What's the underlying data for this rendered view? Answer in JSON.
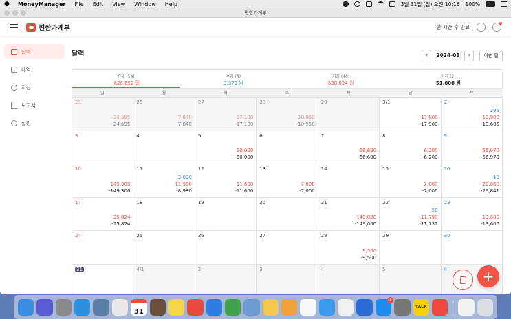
{
  "menubar": {
    "app_name": "MoneyManager",
    "items": [
      "File",
      "Edit",
      "View",
      "Window",
      "Help"
    ],
    "datetime": "3월 31일 (일) 오전 10:16",
    "battery": "100%"
  },
  "window": {
    "title": "편한가계부"
  },
  "appbar": {
    "brand": "편한가계부",
    "sync_label": "한 시간 후 만료"
  },
  "sidebar": {
    "items": [
      {
        "label": "달력"
      },
      {
        "label": "내역"
      },
      {
        "label": "자산"
      },
      {
        "label": "보고서"
      },
      {
        "label": "설정"
      }
    ]
  },
  "main": {
    "title": "달력",
    "month": "2024-03",
    "today_label": "이번 달"
  },
  "summary": [
    {
      "label": "전체 (54)",
      "value": "-626,652 원"
    },
    {
      "label": "수입 (4)",
      "value": "3,372 원"
    },
    {
      "label": "지출 (48)",
      "value": "630,024 원"
    },
    {
      "label": "이체 (2)",
      "value": "51,000 원"
    }
  ],
  "weekdays": [
    "일",
    "월",
    "화",
    "수",
    "목",
    "금",
    "토"
  ],
  "calendar": [
    {
      "day": "25",
      "expense": "24,595",
      "net": "-24,595"
    },
    {
      "day": "26",
      "expense": "7,840",
      "net": "-7,840"
    },
    {
      "day": "27",
      "expense": "17,100",
      "net": "-17,100"
    },
    {
      "day": "28",
      "expense": "10,950",
      "net": "-10,950"
    },
    {
      "day": "29"
    },
    {
      "day": "3/1",
      "expense": "17,900",
      "net": "-17,900"
    },
    {
      "day": "2",
      "income": "295",
      "expense": "10,900",
      "net": "-10,605"
    },
    {
      "day": "3"
    },
    {
      "day": "4"
    },
    {
      "day": "5",
      "expense": "50,000",
      "net": "-50,000"
    },
    {
      "day": "6"
    },
    {
      "day": "7",
      "expense": "66,600",
      "net": "-66,600"
    },
    {
      "day": "8",
      "expense": "6,200",
      "net": "-6,200"
    },
    {
      "day": "9",
      "expense": "56,970",
      "net": "-56,970"
    },
    {
      "day": "10",
      "expense": "149,300",
      "net": "-149,300"
    },
    {
      "day": "11",
      "income": "3,000",
      "expense": "11,980",
      "net": "-8,980"
    },
    {
      "day": "12",
      "expense": "11,600",
      "net": "-11,600"
    },
    {
      "day": "13",
      "expense": "7,000",
      "net": "-7,000"
    },
    {
      "day": "14"
    },
    {
      "day": "15",
      "expense": "2,000",
      "net": "-2,000"
    },
    {
      "day": "16",
      "income": "19",
      "expense": "29,860",
      "net": "-29,841"
    },
    {
      "day": "17",
      "expense": "25,824",
      "net": "-25,824"
    },
    {
      "day": "18"
    },
    {
      "day": "19"
    },
    {
      "day": "20"
    },
    {
      "day": "21",
      "expense": "149,000",
      "net": "-149,000"
    },
    {
      "day": "22",
      "income": "58",
      "expense": "11,790",
      "net": "-11,732"
    },
    {
      "day": "23",
      "expense": "13,600",
      "net": "-13,600"
    },
    {
      "day": "24"
    },
    {
      "day": "25"
    },
    {
      "day": "26"
    },
    {
      "day": "27"
    },
    {
      "day": "28",
      "expense": "9,500",
      "net": "-9,500"
    },
    {
      "day": "29"
    },
    {
      "day": "30"
    },
    {
      "day": "31"
    },
    {
      "day": "4/1"
    },
    {
      "day": "2"
    },
    {
      "day": "3"
    },
    {
      "day": "4"
    },
    {
      "day": "5"
    },
    {
      "day": "6"
    }
  ],
  "colors": {
    "accent": "#ef4a3f",
    "income": "#2f89d8",
    "dock_badge": "#ef4a3f"
  },
  "dock_icons": [
    "finder-icon",
    "siri-icon",
    "launchpad-icon",
    "safari-icon",
    "preview-icon",
    "chrome-icon",
    "calendar-icon",
    "notes-icon",
    "stickies-icon",
    "app-icon",
    "keynote-icon",
    "numbers-icon",
    "preview-icon",
    "stickies-icon",
    "pages-icon",
    "photos-icon",
    "messages-icon",
    "music-icon",
    "quicktime-icon",
    "appstore-icon",
    "settings-icon",
    "kakaotalk-icon",
    "moneymanager-icon",
    "document-icon",
    "trash-icon"
  ],
  "dock_calendar_day": "31",
  "dock_kakao_label": "TALK",
  "dock_appstore_badge": "1"
}
